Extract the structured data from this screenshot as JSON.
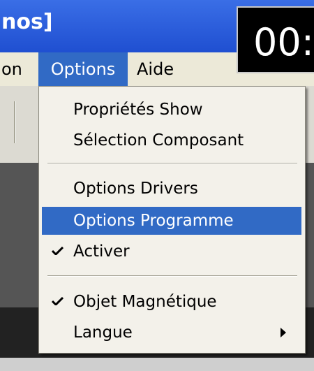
{
  "window": {
    "title_fragment": "nos]"
  },
  "timer": {
    "text": "00:"
  },
  "menubar": {
    "items": [
      {
        "label": "on"
      },
      {
        "label": "Options"
      },
      {
        "label": "Aide"
      }
    ]
  },
  "options_menu": {
    "items": [
      {
        "label": "Propriétés Show"
      },
      {
        "label": "Sélection Composant"
      },
      {
        "label": "Options Drivers"
      },
      {
        "label": "Options Programme",
        "highlighted": true
      },
      {
        "label": "Activer",
        "checked": true
      },
      {
        "label": "Objet Magnétique",
        "checked": true
      },
      {
        "label": "Langue",
        "submenu": true
      }
    ]
  },
  "colors": {
    "titlebar": "#2358d9",
    "highlight": "#316ac5",
    "menu_bg": "#f3f1ea"
  }
}
